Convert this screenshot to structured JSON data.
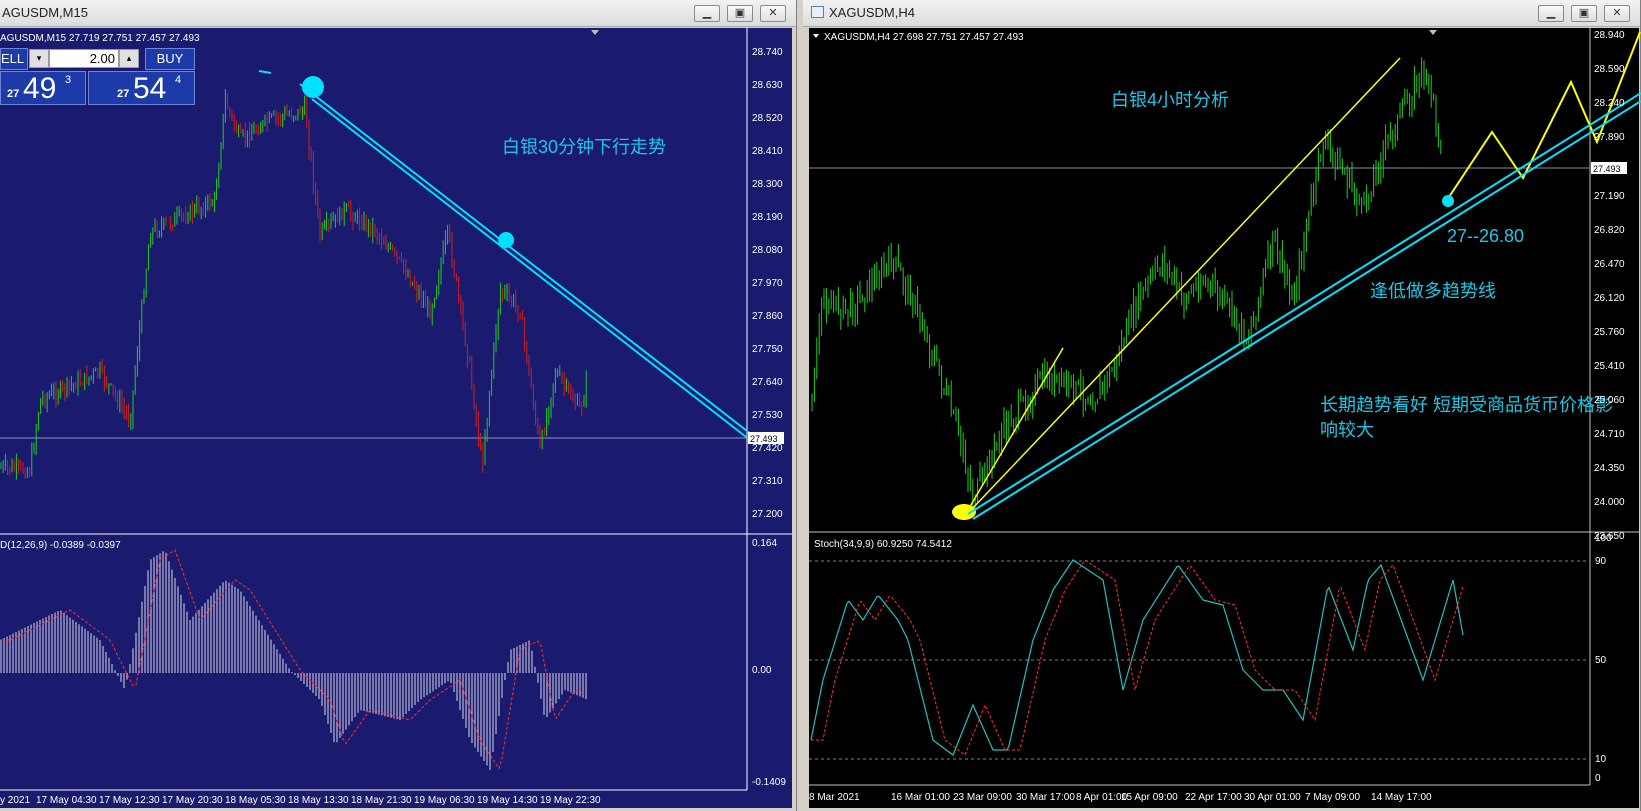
{
  "left_window": {
    "title": "AGUSDM,M15",
    "header": "AGUSDM,M15  27.719 27.751 27.457 27.493",
    "trade": {
      "sell_label": "ELL",
      "buy_label": "BUY",
      "lots": "2.00",
      "bid_small": "27",
      "bid_big": "49",
      "bid_sup": "3",
      "ask_small": "27",
      "ask_big": "54",
      "ask_sup": "4"
    },
    "annotation": "白银30分钟下行走势",
    "price_axis": [
      "28.740",
      "28.630",
      "28.520",
      "28.410",
      "28.300",
      "28.190",
      "28.080",
      "27.970",
      "27.860",
      "27.750",
      "27.640",
      "27.530",
      "27.420",
      "27.310",
      "27.200"
    ],
    "current_price": "27.493",
    "indicator_label": "D(12,26,9) -0.0389 -0.0397",
    "indicator_axis": [
      "0.164",
      "0.00",
      "-0.1409"
    ],
    "time_axis": [
      "y 2021",
      "17 May 04:30",
      "17 May 12:30",
      "17 May 20:30",
      "18 May 05:30",
      "18 May 13:30",
      "18 May 21:30",
      "19 May 06:30",
      "19 May 14:30",
      "19 May 22:30"
    ]
  },
  "right_window": {
    "title": "XAGUSDM,H4",
    "header": "XAGUSDM,H4  27.698 27.751 27.457 27.493",
    "annotation_title": "白银4小时分析",
    "annotation_range": "27--26.80",
    "annotation_trend": "逢低做多趋势线",
    "annotation_note_1": "长期趋势看好 短期受商品货币价格影",
    "annotation_note_2": "响较大",
    "price_axis": [
      "28.940",
      "28.590",
      "28.240",
      "27.890",
      "27.190",
      "26.820",
      "26.470",
      "26.120",
      "25.760",
      "25.410",
      "25.060",
      "24.710",
      "24.350",
      "24.000",
      "23.650"
    ],
    "current_price": "27.493",
    "indicator_label": "Stoch(34,9,9) 60.9250 74.5412",
    "indicator_axis": [
      "100",
      "90",
      "50",
      "10",
      "0"
    ],
    "time_axis": [
      "8 Mar 2021",
      "16 Mar 01:00",
      "23 Mar 09:00",
      "30 Mar 17:00",
      "8 Apr 01:00",
      "15 Apr 09:00",
      "22 Apr 17:00",
      "30 Apr 01:00",
      "7 May 09:00",
      "14 May 17:00"
    ]
  },
  "colors": {
    "left_bg": "#1a1a6e",
    "right_bg": "#000000",
    "bull": "#22cc22",
    "bear": "#cc2222",
    "trend": "#00e0ff",
    "annot": "#19c8e6",
    "yellow": "#ffff00",
    "signal": "#ff3030"
  }
}
